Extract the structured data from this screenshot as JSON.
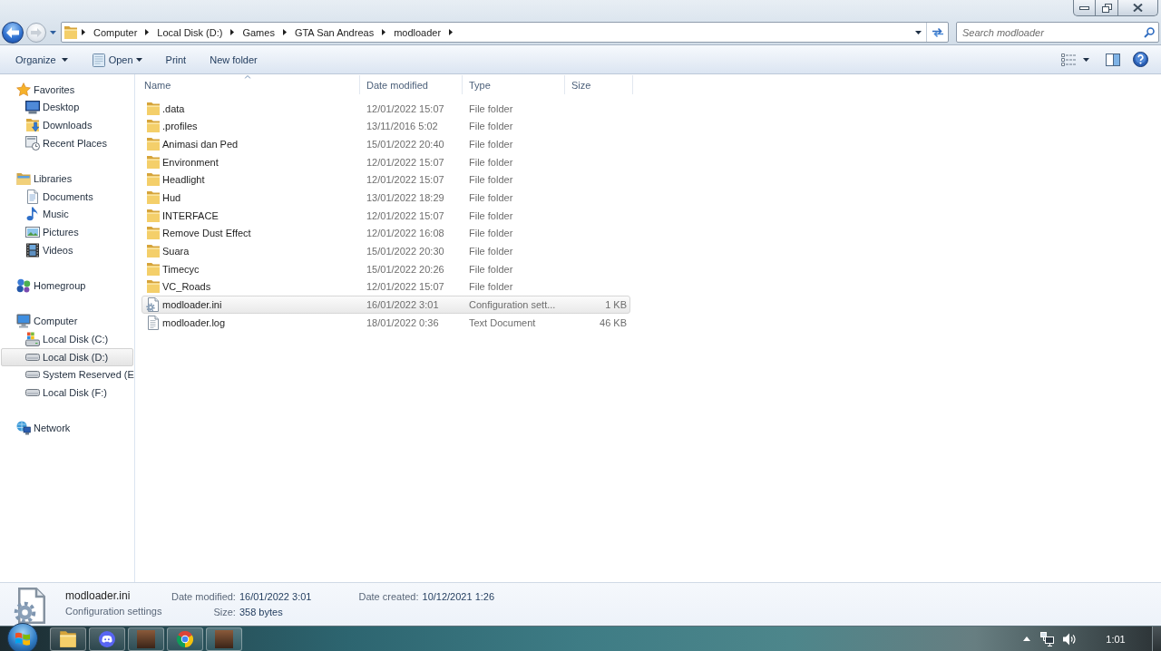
{
  "navigation": {
    "back": {
      "disabled": false
    },
    "forward": {
      "disabled": true
    }
  },
  "address_bar": {
    "breadcrumbs": [
      "Computer",
      "Local Disk (D:)",
      "Games",
      "GTA San Andreas",
      "modloader"
    ]
  },
  "search": {
    "placeholder": "Search modloader"
  },
  "toolbar": {
    "commands": [
      {
        "label": "Organize",
        "kind": "menu"
      },
      {
        "label": "Open",
        "kind": "app-menu"
      },
      {
        "label": "Print",
        "kind": "plain"
      },
      {
        "label": "New folder",
        "kind": "plain"
      }
    ]
  },
  "sidebar": {
    "groups": [
      {
        "label": "Favorites",
        "kind": "star",
        "selected": false,
        "children": [
          {
            "label": "Desktop",
            "kind": "desktop",
            "selected": false
          },
          {
            "label": "Downloads",
            "kind": "downloads",
            "selected": false
          },
          {
            "label": "Recent Places",
            "kind": "recent",
            "selected": false
          }
        ]
      },
      {
        "label": "Libraries",
        "kind": "library",
        "selected": false,
        "children": [
          {
            "label": "Documents",
            "kind": "documents",
            "selected": false
          },
          {
            "label": "Music",
            "kind": "music",
            "selected": false
          },
          {
            "label": "Pictures",
            "kind": "pictures",
            "selected": false
          },
          {
            "label": "Videos",
            "kind": "videos",
            "selected": false
          }
        ]
      },
      {
        "label": "Homegroup",
        "kind": "homegroup",
        "selected": false
      },
      {
        "label": "Computer",
        "kind": "computer",
        "selected": false,
        "children": [
          {
            "label": "Local Disk (C:)",
            "kind": "system-drive",
            "selected": false
          },
          {
            "label": "Local Disk (D:)",
            "kind": "drive",
            "selected": true
          },
          {
            "label": "System Reserved (E",
            "kind": "drive",
            "selected": false
          },
          {
            "label": "Local Disk (F:)",
            "kind": "drive",
            "selected": false
          }
        ]
      },
      {
        "label": "Network",
        "kind": "network",
        "selected": false
      }
    ]
  },
  "file_list": {
    "columns": [
      {
        "label": "Name",
        "sorted": true
      },
      {
        "label": "Date modified",
        "sorted": false
      },
      {
        "label": "Type",
        "sorted": false
      },
      {
        "label": "Size",
        "sorted": false
      }
    ],
    "rows": [
      {
        "kind": "folder",
        "name": ".data",
        "date_modified": "12/01/2022 15:07",
        "type": "File folder",
        "selected": false
      },
      {
        "kind": "folder",
        "name": ".profiles",
        "date_modified": "13/11/2016 5:02",
        "type": "File folder",
        "selected": false
      },
      {
        "kind": "folder",
        "name": "Animasi dan Ped",
        "date_modified": "15/01/2022 20:40",
        "type": "File folder",
        "selected": false
      },
      {
        "kind": "folder",
        "name": "Environment",
        "date_modified": "12/01/2022 15:07",
        "type": "File folder",
        "selected": false
      },
      {
        "kind": "folder",
        "name": "Headlight",
        "date_modified": "12/01/2022 15:07",
        "type": "File folder",
        "selected": false
      },
      {
        "kind": "folder",
        "name": "Hud",
        "date_modified": "13/01/2022 18:29",
        "type": "File folder",
        "selected": false
      },
      {
        "kind": "folder",
        "name": "INTERFACE",
        "date_modified": "12/01/2022 15:07",
        "type": "File folder",
        "selected": false
      },
      {
        "kind": "folder",
        "name": "Remove Dust Effect",
        "date_modified": "12/01/2022 16:08",
        "type": "File folder",
        "selected": false
      },
      {
        "kind": "folder",
        "name": "Suara",
        "date_modified": "15/01/2022 20:30",
        "type": "File folder",
        "selected": false
      },
      {
        "kind": "folder",
        "name": "Timecyc",
        "date_modified": "15/01/2022 20:26",
        "type": "File folder",
        "selected": false
      },
      {
        "kind": "folder",
        "name": "VC_Roads",
        "date_modified": "12/01/2022 15:07",
        "type": "File folder",
        "selected": false
      },
      {
        "kind": "settings",
        "name": "modloader.ini",
        "date_modified": "16/01/2022 3:01",
        "type": "Configuration sett...",
        "size": "1 KB",
        "selected": true
      },
      {
        "kind": "text",
        "name": "modloader.log",
        "date_modified": "18/01/2022 0:36",
        "type": "Text Document",
        "size": "46 KB",
        "selected": false
      }
    ]
  },
  "details_pane": {
    "kind": "settings",
    "name": "modloader.ini",
    "type": "Configuration settings",
    "fields": [
      {
        "label": "Date modified:",
        "value": "16/01/2022 3:01"
      },
      {
        "label": "Size:",
        "value": "358 bytes"
      },
      {
        "label": "Date created:",
        "value": "10/12/2021 1:26"
      }
    ]
  },
  "taskbar": {
    "apps": [
      {
        "kind": "folder"
      },
      {
        "kind": "chat"
      },
      {
        "kind": "picture"
      },
      {
        "kind": "browser"
      },
      {
        "kind": "picture"
      }
    ],
    "clock": "1:01"
  }
}
